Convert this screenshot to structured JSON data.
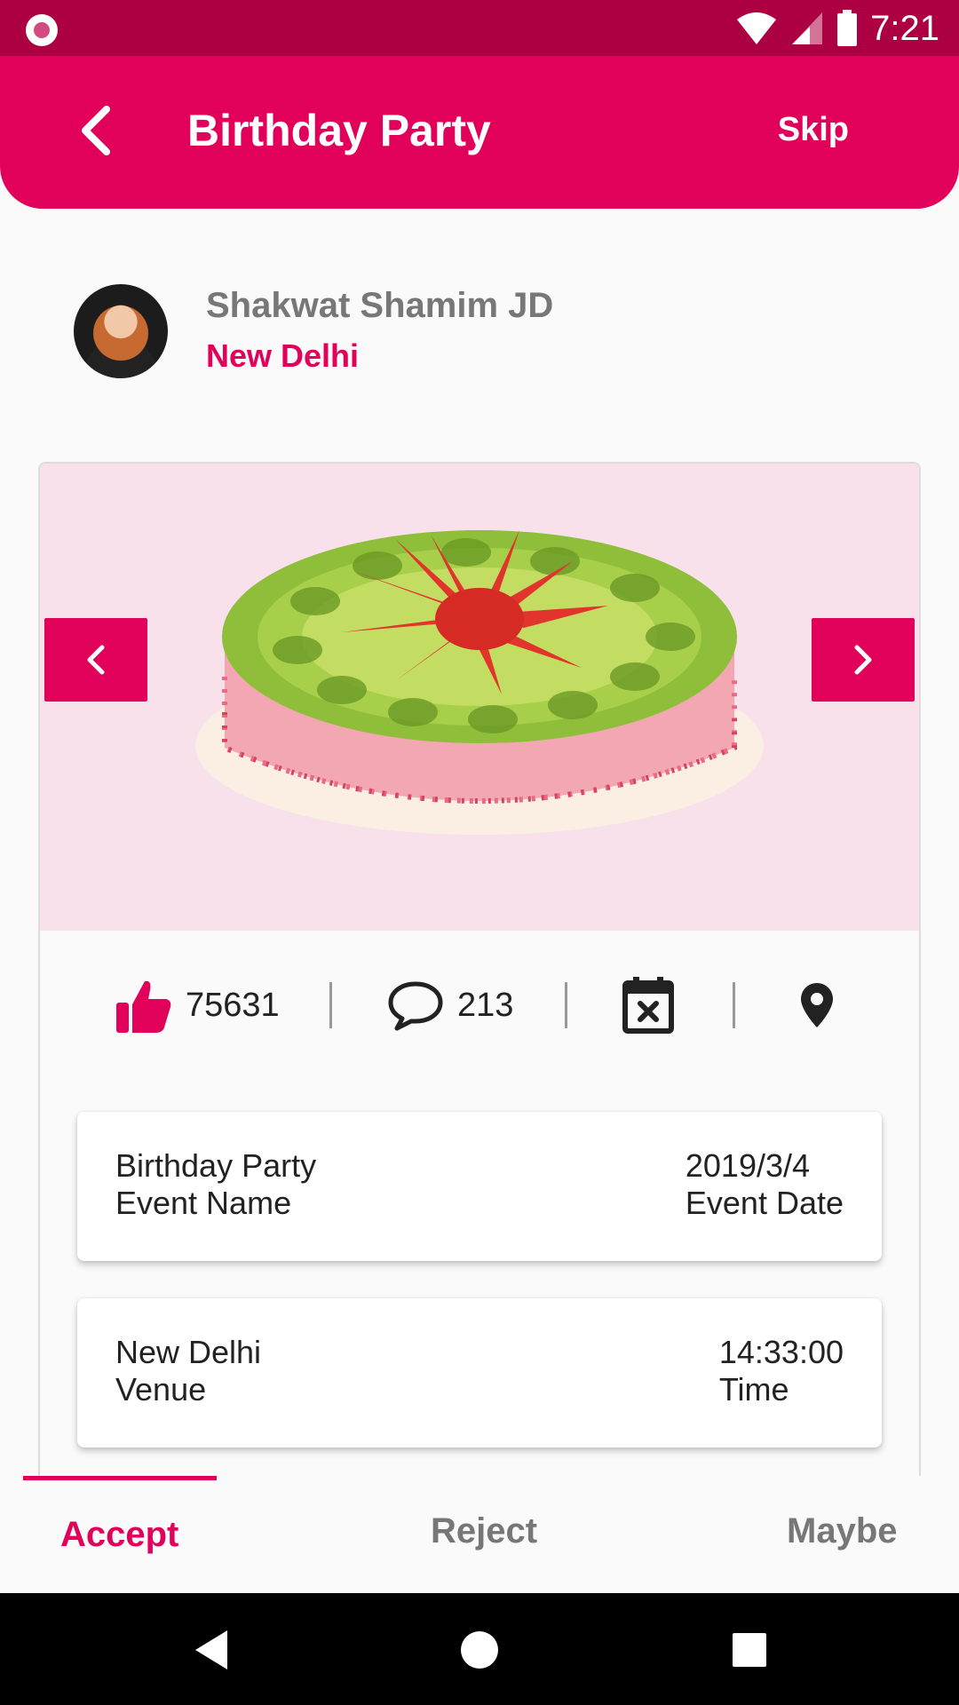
{
  "status_bar": {
    "time": "7:21"
  },
  "app_bar": {
    "title": "Birthday Party",
    "skip_label": "Skip"
  },
  "profile": {
    "name": "Shakwat Shamim JD",
    "city": "New Delhi"
  },
  "stats": {
    "likes": "75631",
    "comments": "213"
  },
  "event_name_box": {
    "name_value": "Birthday Party",
    "name_label": "Event Name",
    "date_value": "2019/3/4",
    "date_label": "Event Date"
  },
  "venue_box": {
    "venue_value": "New Delhi",
    "venue_label": "Venue",
    "time_value": "14:33:00",
    "time_label": "Time"
  },
  "tabs": [
    {
      "label": "Accept",
      "active": true
    },
    {
      "label": "Reject",
      "active": false
    },
    {
      "label": "Maybe",
      "active": false
    }
  ],
  "colors": {
    "primary": "#e1005a",
    "status_bar": "#ad0043",
    "image_bg": "#f8e1ea"
  }
}
